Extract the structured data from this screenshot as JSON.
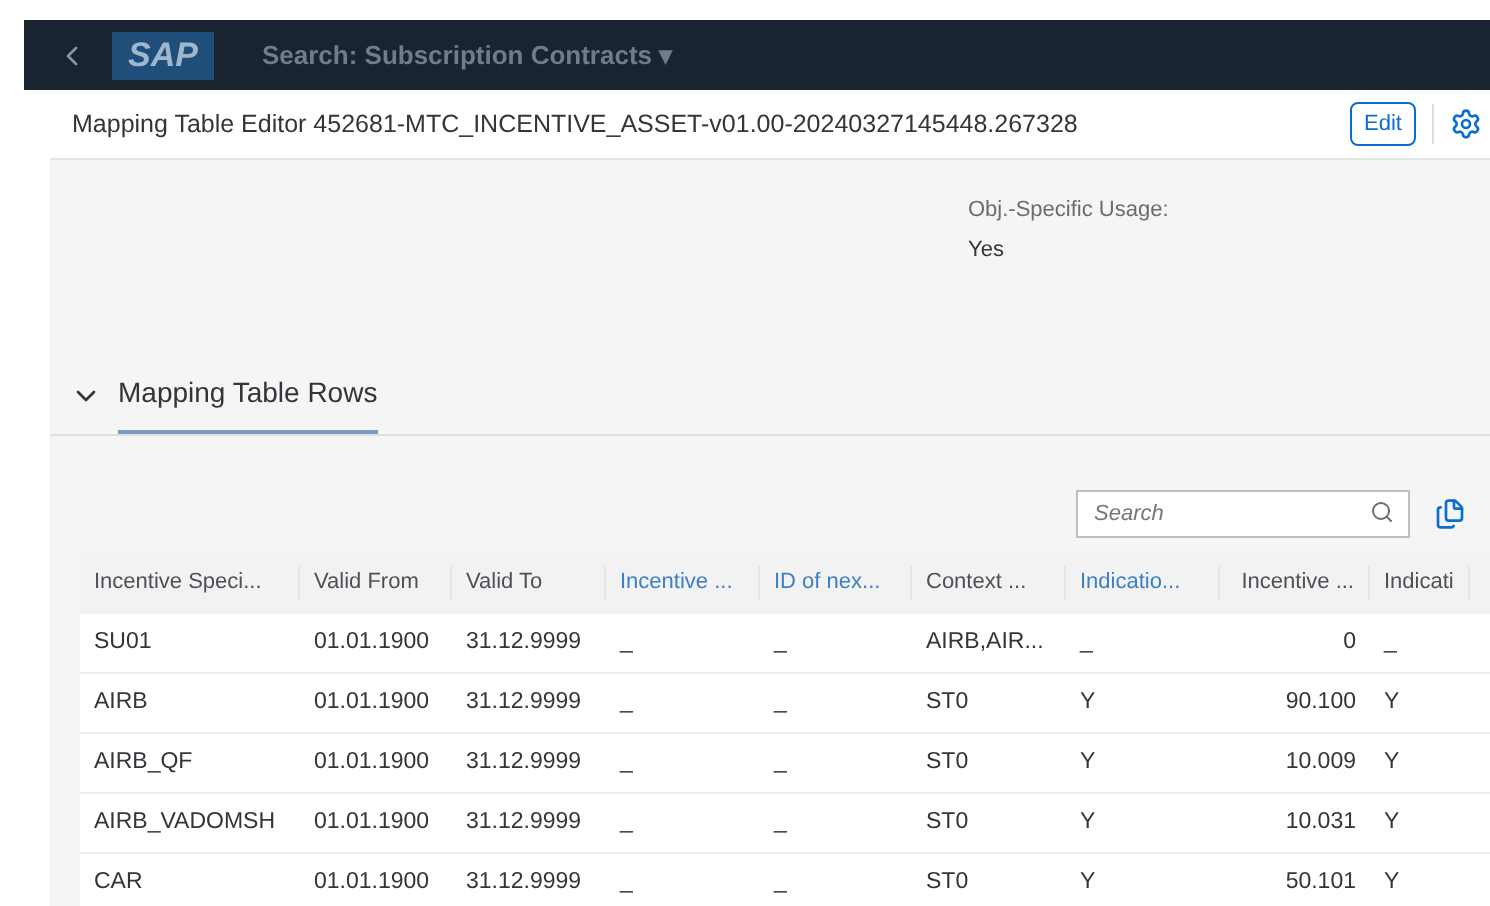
{
  "shell_bar": {
    "logo": "SAP",
    "title": "Search: Subscription Contracts",
    "title_caret": "▾"
  },
  "header": {
    "title": "Mapping Table Editor 452681-MTC_INCENTIVE_ASSET-v01.00-20240327145448.267328",
    "edit_button": "Edit"
  },
  "attribute": {
    "label": "Obj.-Specific Usage:",
    "value": "Yes"
  },
  "section": {
    "title": "Mapping Table Rows",
    "expanded": true
  },
  "search": {
    "placeholder": "Search"
  },
  "table": {
    "columns": [
      {
        "label": "Incentive Speci...",
        "kind": "plain"
      },
      {
        "label": "Valid From",
        "kind": "plain"
      },
      {
        "label": "Valid To",
        "kind": "plain"
      },
      {
        "label": "Incentive ...",
        "kind": "link"
      },
      {
        "label": "ID of nex...",
        "kind": "link"
      },
      {
        "label": "Context ...",
        "kind": "plain"
      },
      {
        "label": "Indicatio...",
        "kind": "link"
      },
      {
        "label": "Incentive ...",
        "kind": "numeric"
      },
      {
        "label": "Indicati",
        "kind": "plain"
      }
    ],
    "rows": [
      [
        "SU01",
        "01.01.1900",
        "31.12.9999",
        "_",
        "_",
        "AIRB,AIR...",
        "_",
        "0",
        "_"
      ],
      [
        "AIRB",
        "01.01.1900",
        "31.12.9999",
        "_",
        "_",
        "ST0",
        "Y",
        "90.100",
        "Y"
      ],
      [
        "AIRB_QF",
        "01.01.1900",
        "31.12.9999",
        "_",
        "_",
        "ST0",
        "Y",
        "10.009",
        "Y"
      ],
      [
        "AIRB_VADOMSH",
        "01.01.1900",
        "31.12.9999",
        "_",
        "_",
        "ST0",
        "Y",
        "10.031",
        "Y"
      ],
      [
        "CAR",
        "01.01.1900",
        "31.12.9999",
        "_",
        "_",
        "ST0",
        "Y",
        "50.101",
        "Y"
      ]
    ]
  }
}
